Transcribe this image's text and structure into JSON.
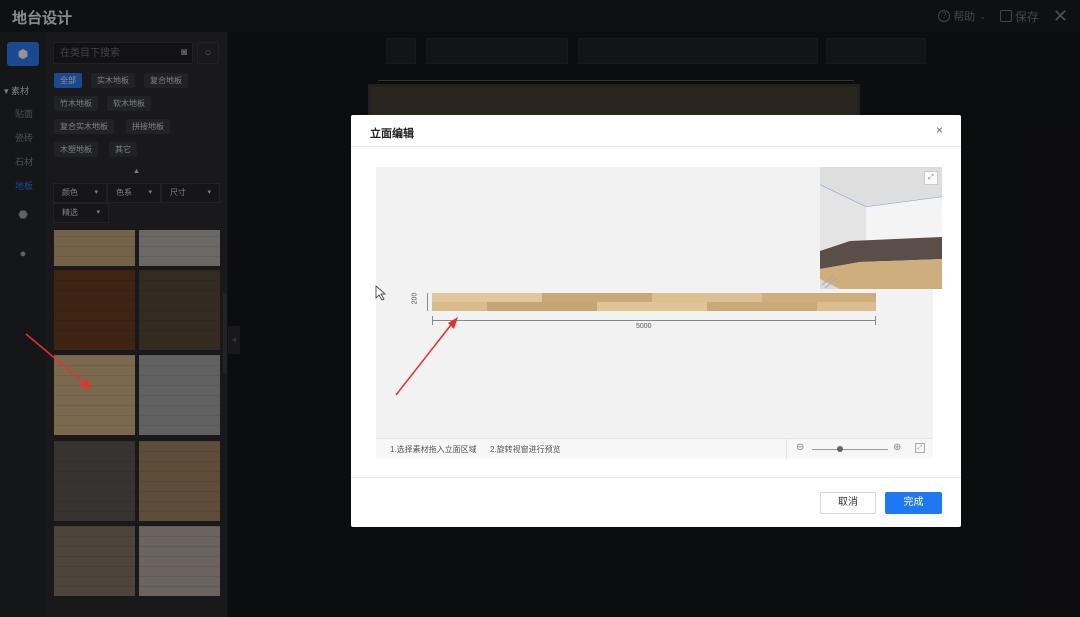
{
  "app": {
    "title": "地台设计"
  },
  "top_actions": {
    "help": "帮助",
    "save": "保存",
    "help_icon": "help-circle-icon",
    "save_icon": "save-icon",
    "close_icon": "close-icon"
  },
  "rail": {
    "category": "素材",
    "items": [
      "贴面",
      "瓷砖",
      "石材",
      "地板"
    ],
    "active_item": "地板"
  },
  "library": {
    "search_placeholder": "在类目下搜索",
    "tags": [
      "全部",
      "实木地板",
      "复合地板",
      "竹木地板",
      "软木地板",
      "复合实木地板",
      "拼接地板",
      "木塑地板",
      "其它"
    ],
    "active_tag": "全部",
    "filters": [
      "颜色",
      "色系",
      "尺寸",
      "精选"
    ],
    "swatch_colors": [
      "#c9a97f",
      "#b9b6b0",
      "#6b3f22",
      "#5a4a3c",
      "#d4b588",
      "#a8a8a8",
      "#5d5955",
      "#a08663",
      "#857568",
      "#b8ada2"
    ]
  },
  "modal": {
    "title": "立面编辑",
    "close": "×",
    "hints": [
      "1.选择素材拖入立面区域",
      "2.旋转视窗进行预览"
    ],
    "dim_height": "200",
    "dim_width": "5000",
    "cancel": "取消",
    "done": "完成"
  },
  "colors": {
    "accent": "#1e78f2",
    "annotation_arrow": "#e8312a"
  }
}
